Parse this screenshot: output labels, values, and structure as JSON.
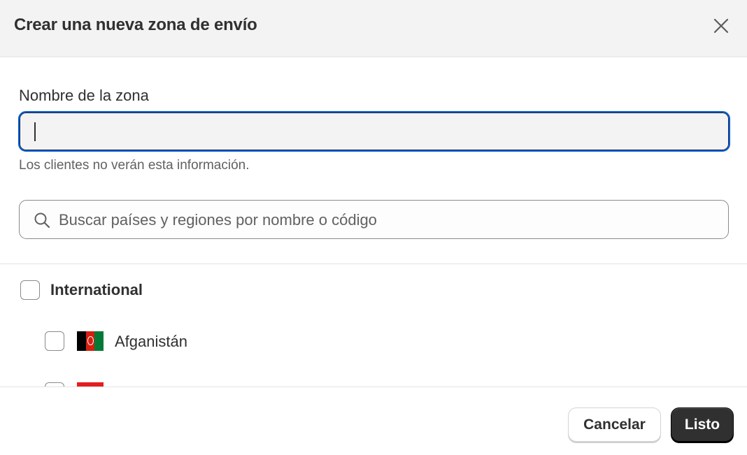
{
  "dialog": {
    "title": "Crear una nueva zona de envío",
    "close_icon": "close-icon"
  },
  "zone_name": {
    "label": "Nombre de la zona",
    "value": "",
    "help_text": "Los clientes no verán esta información."
  },
  "search": {
    "icon": "search-icon",
    "placeholder": "Buscar países y regiones por nombre o código",
    "value": ""
  },
  "regions": {
    "group": {
      "label": "International",
      "checked": false
    },
    "countries": [
      {
        "name": "Afganistán",
        "checked": false,
        "flag": "afghanistan-flag",
        "flag_colors": [
          "#000000",
          "#d32011",
          "#007a36"
        ]
      },
      {
        "name": "",
        "checked": false,
        "flag": "partial-flag",
        "flag_colors": [
          "#e41e20"
        ]
      }
    ]
  },
  "footer": {
    "cancel_label": "Cancelar",
    "done_label": "Listo"
  },
  "colors": {
    "focus_ring": "#005bd3",
    "primary_button": "#303030",
    "header_background": "#f3f3f3"
  }
}
